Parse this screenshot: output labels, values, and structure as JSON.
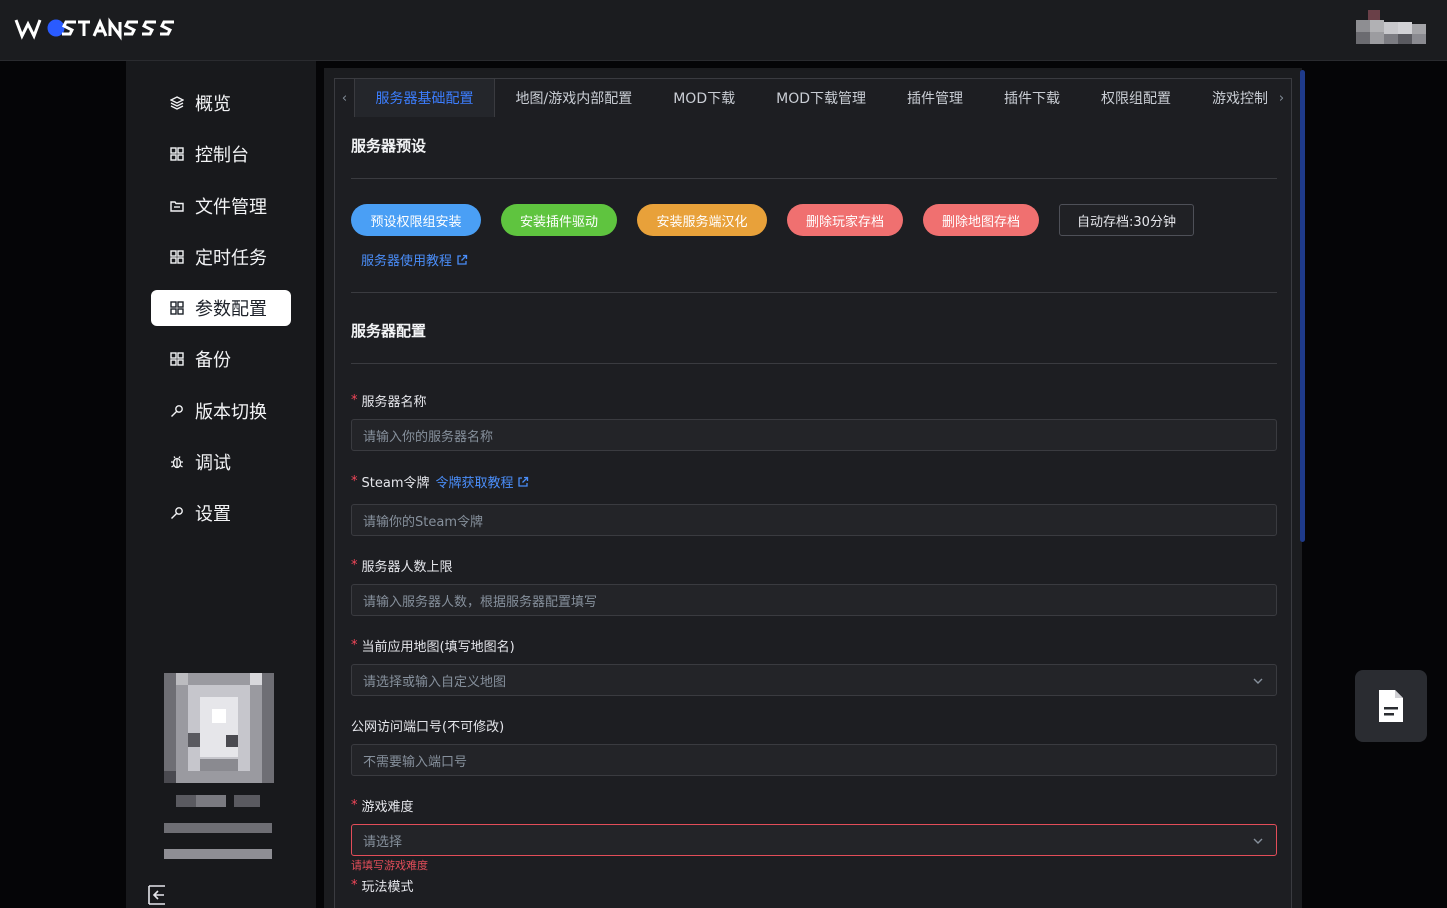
{
  "app": {
    "logo_text": "WOSTONSS",
    "accent_color": "#3c7eff",
    "background_color": "#050507"
  },
  "sidebar": {
    "items": [
      {
        "label": "概览",
        "icon": "layers-icon",
        "active": false
      },
      {
        "label": "控制台",
        "icon": "grid-icon",
        "active": false
      },
      {
        "label": "文件管理",
        "icon": "folder-icon",
        "active": false
      },
      {
        "label": "定时任务",
        "icon": "grid-icon",
        "active": false
      },
      {
        "label": "参数配置",
        "icon": "grid-icon",
        "active": true
      },
      {
        "label": "备份",
        "icon": "grid-icon",
        "active": false
      },
      {
        "label": "版本切换",
        "icon": "wrench-icon",
        "active": false
      },
      {
        "label": "调试",
        "icon": "bug-icon",
        "active": false
      },
      {
        "label": "设置",
        "icon": "wrench-icon",
        "active": false
      }
    ],
    "collapse_icon": "collapse-left-icon"
  },
  "tabs": {
    "items": [
      {
        "label": "服务器基础配置",
        "active": true
      },
      {
        "label": "地图/游戏内部配置",
        "active": false
      },
      {
        "label": "MOD下载",
        "active": false
      },
      {
        "label": "MOD下载管理",
        "active": false
      },
      {
        "label": "插件管理",
        "active": false
      },
      {
        "label": "插件下载",
        "active": false
      },
      {
        "label": "权限组配置",
        "active": false
      },
      {
        "label": "游戏控制",
        "active": false
      }
    ]
  },
  "preset": {
    "title": "服务器预设",
    "buttons": [
      {
        "label": "预设权限组安装",
        "color": "#4a9ff5"
      },
      {
        "label": "安装插件驱动",
        "color": "#5fc43f"
      },
      {
        "label": "安装服务端汉化",
        "color": "#e8a13a"
      },
      {
        "label": "删除玩家存档",
        "color": "#f07070"
      },
      {
        "label": "删除地图存档",
        "color": "#f07070"
      }
    ],
    "autosave_label": "自动存档:30分钟",
    "tutorial_link": "服务器使用教程"
  },
  "config": {
    "title": "服务器配置",
    "fields": {
      "server_name": {
        "label": "服务器名称",
        "placeholder": "请输入你的服务器名称",
        "required": true
      },
      "steam_token": {
        "label": "Steam令牌",
        "placeholder": "请输你的Steam令牌",
        "required": true,
        "link": "令牌获取教程"
      },
      "max_players": {
        "label": "服务器人数上限",
        "placeholder": "请输入服务器人数，根据服务器配置填写",
        "required": true
      },
      "map": {
        "label": "当前应用地图(填写地图名)",
        "placeholder": "请选择或输入自定义地图",
        "required": true
      },
      "port": {
        "label": "公网访问端口号(不可修改)",
        "placeholder": "不需要输入端口号",
        "required": false
      },
      "difficulty": {
        "label": "游戏难度",
        "placeholder": "请选择",
        "required": true,
        "error": "请填写游戏难度"
      },
      "mode": {
        "label": "玩法模式",
        "required": true
      }
    }
  },
  "floating": {
    "icon": "document-icon"
  }
}
